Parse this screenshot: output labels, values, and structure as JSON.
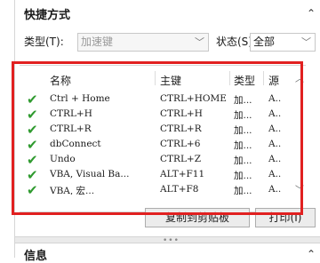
{
  "panel": {
    "title": "快捷方式",
    "collapse_icon": "⌃"
  },
  "filters": {
    "type_label": "类型(T):",
    "type_value": "加速键",
    "status_label": "状态(S)",
    "status_value": "全部"
  },
  "columns": [
    "名称",
    "主键",
    "类型",
    "源"
  ],
  "rows": [
    {
      "name": "Ctrl + Home",
      "key": "CTRL+HOME",
      "type": "加...",
      "source": "A.."
    },
    {
      "name": "CTRL+H",
      "key": "CTRL+H",
      "type": "加...",
      "source": "A.."
    },
    {
      "name": "CTRL+R",
      "key": "CTRL+R",
      "type": "加...",
      "source": "A.."
    },
    {
      "name": "dbConnect",
      "key": "CTRL+6",
      "type": "加...",
      "source": "A.."
    },
    {
      "name": "Undo",
      "key": "CTRL+Z",
      "type": "加...",
      "source": "A.."
    },
    {
      "name": "VBA, Visual Ba...",
      "key": "ALT+F11",
      "type": "加...",
      "source": "A.."
    },
    {
      "name": "VBA, 宏...",
      "key": "ALT+F8",
      "type": "加...",
      "source": "A.."
    }
  ],
  "buttons": {
    "copy": "复制到剪贴板",
    "print": "打印(I)"
  },
  "panel2": {
    "title": "信息",
    "collapse_icon": "⌃"
  },
  "colors": {
    "highlight": "#e12020",
    "check": "#2f9a2f"
  }
}
